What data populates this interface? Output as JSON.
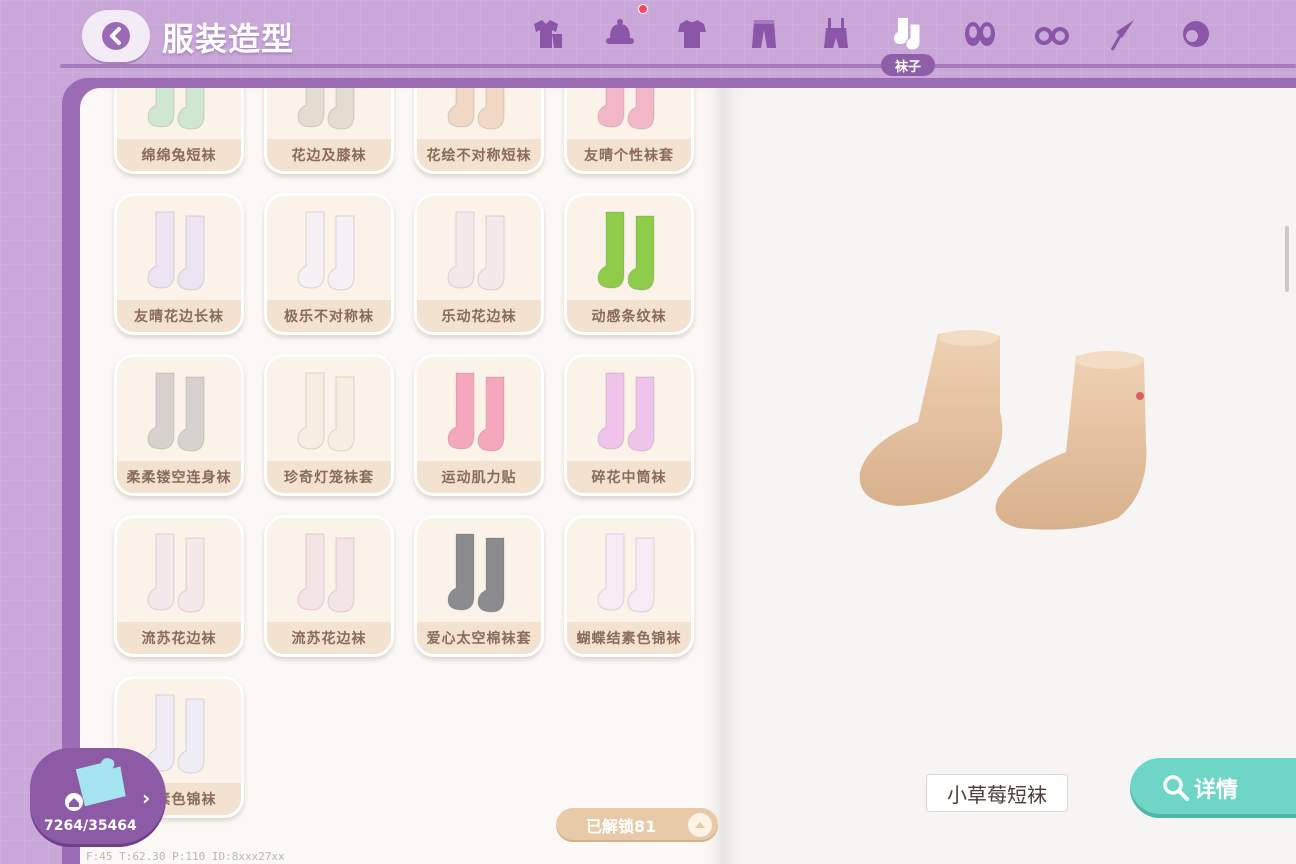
{
  "header": {
    "title": "服装造型",
    "active_tab_label": "袜子"
  },
  "category_tabs": [
    {
      "icon": "outfit-icon",
      "active": false
    },
    {
      "icon": "hat-icon",
      "active": false,
      "notification": true
    },
    {
      "icon": "top-icon",
      "active": false
    },
    {
      "icon": "pants-icon",
      "active": false
    },
    {
      "icon": "overalls-icon",
      "active": false
    },
    {
      "icon": "socks-icon",
      "active": true
    },
    {
      "icon": "shoes-icon",
      "active": false
    },
    {
      "icon": "glasses-icon",
      "active": false
    },
    {
      "icon": "umbrella-icon",
      "active": false
    },
    {
      "icon": "hair-icon",
      "active": false
    }
  ],
  "items": [
    {
      "name": "绵绵兔短袜",
      "color": "#cfe6cf"
    },
    {
      "name": "花边及膝袜",
      "color": "#e3ddd0"
    },
    {
      "name": "花绘不对称短袜",
      "color": "#f0d8c4"
    },
    {
      "name": "友晴个性袜套",
      "color": "#f2b8c8"
    },
    {
      "name": "友晴花边长袜",
      "color": "#ece4f2"
    },
    {
      "name": "极乐不对称袜",
      "color": "#f4f0f4"
    },
    {
      "name": "乐动花边袜",
      "color": "#f4e8ea"
    },
    {
      "name": "动感条纹袜",
      "color": "#8fcc4a"
    },
    {
      "name": "柔柔镂空连身袜",
      "color": "#d8d2ce"
    },
    {
      "name": "珍奇灯笼袜套",
      "color": "#f4efe0"
    },
    {
      "name": "运动肌力贴",
      "color": "#f5a8bc"
    },
    {
      "name": "碎花中筒袜",
      "color": "#f0c4ea"
    },
    {
      "name": "流苏花边袜",
      "color": "#f6e8ea"
    },
    {
      "name": "流苏花边袜",
      "color": "#f4e4e6"
    },
    {
      "name": "爱心太空棉袜套",
      "color": "#8c8c90"
    },
    {
      "name": "蝴蝶结素色锦袜",
      "color": "#f6ecf6"
    },
    {
      "name": "结素色锦袜",
      "color": "#f0ecf6"
    }
  ],
  "unlocked": {
    "label": "已解锁81"
  },
  "collection": {
    "count": "7264/35464"
  },
  "preview": {
    "item_name": "小草莓短袜"
  },
  "details_button": {
    "label": "详情"
  },
  "debug": {
    "text": "F:45  T:62.30  P:110  ID:8xxx27xx"
  }
}
